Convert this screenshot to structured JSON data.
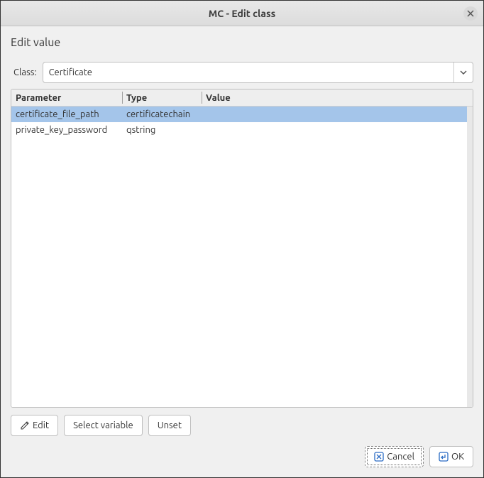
{
  "window": {
    "title": "MC - Edit class"
  },
  "section": {
    "heading": "Edit value"
  },
  "class_selector": {
    "label": "Class:",
    "value": "Certificate"
  },
  "table": {
    "columns": {
      "parameter": "Parameter",
      "type": "Type",
      "value": "Value"
    },
    "rows": [
      {
        "parameter": "certificate_file_path",
        "type": "certificatechain",
        "value": "",
        "selected": true
      },
      {
        "parameter": "private_key_password",
        "type": "qstring",
        "value": "",
        "selected": false
      }
    ]
  },
  "buttons": {
    "edit": "Edit",
    "select_variable": "Select variable",
    "unset": "Unset",
    "cancel": "Cancel",
    "ok": "OK"
  }
}
